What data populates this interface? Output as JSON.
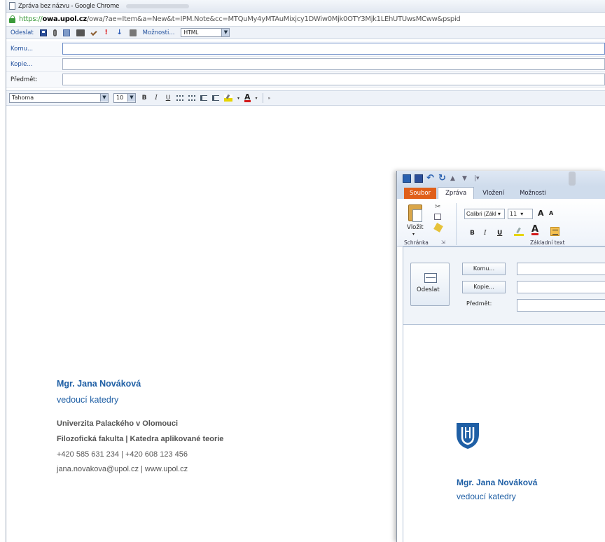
{
  "browser": {
    "title": "Zpráva bez názvu - Google Chrome",
    "url_scheme": "https://",
    "url_domain": "owa.upol.cz",
    "url_rest": "/owa/?ae=Item&a=New&t=IPM.Note&cc=MTQuMy4yMTAuMixjcy1DWiw0Mjk0OTY3Mjk1LEhUTUwsMCww&pspid"
  },
  "owa": {
    "toolbar": {
      "send_label": "Odeslat",
      "options_label": "Možnosti...",
      "format_value": "HTML"
    },
    "fields": {
      "to_label": "Komu...",
      "cc_label": "Kopie...",
      "subject_label": "Předmět:"
    },
    "format": {
      "font": "Tahoma",
      "size": "10",
      "bold": "B",
      "italic": "I",
      "underline": "U"
    },
    "signature": {
      "name": "Mgr. Jana Nováková",
      "role": "vedoucí katedry",
      "org": "Univerzita Palackého v Olomouci",
      "dept": "Filozofická fakulta | Katedra aplikované teorie",
      "phone": "+420 585 631 234 | +420 608 123 456",
      "contact": "jana.novakova@upol.cz | www.upol.cz"
    }
  },
  "outlook": {
    "tabs": {
      "file": "Soubor",
      "message": "Zpráva",
      "insert": "Vložení",
      "options": "Možnosti"
    },
    "ribbon": {
      "paste_label": "Vložit",
      "clipboard_group": "Schránka",
      "font": "Calibri (Zákl",
      "size": "11",
      "grow": "A",
      "shrink": "A",
      "bold": "B",
      "italic": "I",
      "underline": "U",
      "font_color": "A",
      "text_group": "Základní text"
    },
    "header": {
      "send_label": "Odeslat",
      "to_label": "Komu...",
      "cc_label": "Kopie...",
      "subject_label": "Předmět:"
    },
    "signature": {
      "name": "Mgr. Jana Nováková",
      "role": "vedoucí katedry"
    },
    "colors": {
      "file_tab": "#e05f1a",
      "logo": "#1f5fa5"
    }
  }
}
